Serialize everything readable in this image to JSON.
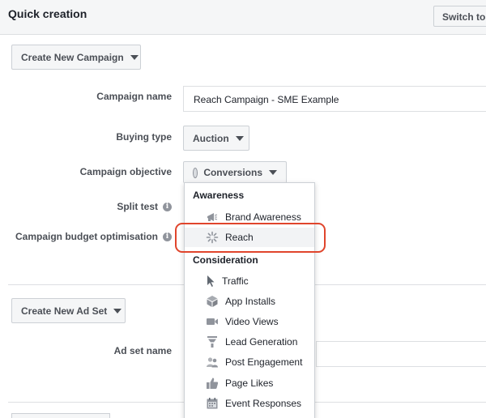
{
  "header": {
    "title": "Quick creation",
    "switch_label": "Switch to"
  },
  "campaign": {
    "create_label": "Create New Campaign",
    "name_label": "Campaign name",
    "name_value": "Reach Campaign - SME Example",
    "buying_type_label": "Buying type",
    "buying_type_value": "Auction",
    "objective_label": "Campaign objective",
    "objective_value": "Conversions",
    "split_test_label": "Split test",
    "budget_opt_label": "Campaign budget optimisation"
  },
  "adset": {
    "create_label": "Create New Ad Set",
    "name_label": "Ad set name"
  },
  "objective_menu": {
    "groups": [
      {
        "header": "Awareness",
        "items": [
          {
            "label": "Brand Awareness",
            "icon": "megaphone-icon"
          },
          {
            "label": "Reach",
            "icon": "reach-icon",
            "selected": true
          }
        ]
      },
      {
        "header": "Consideration",
        "items": [
          {
            "label": "Traffic",
            "icon": "cursor-icon"
          },
          {
            "label": "App Installs",
            "icon": "box-icon"
          },
          {
            "label": "Video Views",
            "icon": "video-camera-icon"
          },
          {
            "label": "Lead Generation",
            "icon": "funnel-icon"
          },
          {
            "label": "Post Engagement",
            "icon": "people-icon"
          },
          {
            "label": "Page Likes",
            "icon": "thumbs-up-icon"
          },
          {
            "label": "Event Responses",
            "icon": "calendar-icon"
          }
        ]
      }
    ]
  },
  "colors": {
    "highlight": "#e0452c",
    "button_bg": "#f5f6f7",
    "label_text": "#4b4f56"
  }
}
